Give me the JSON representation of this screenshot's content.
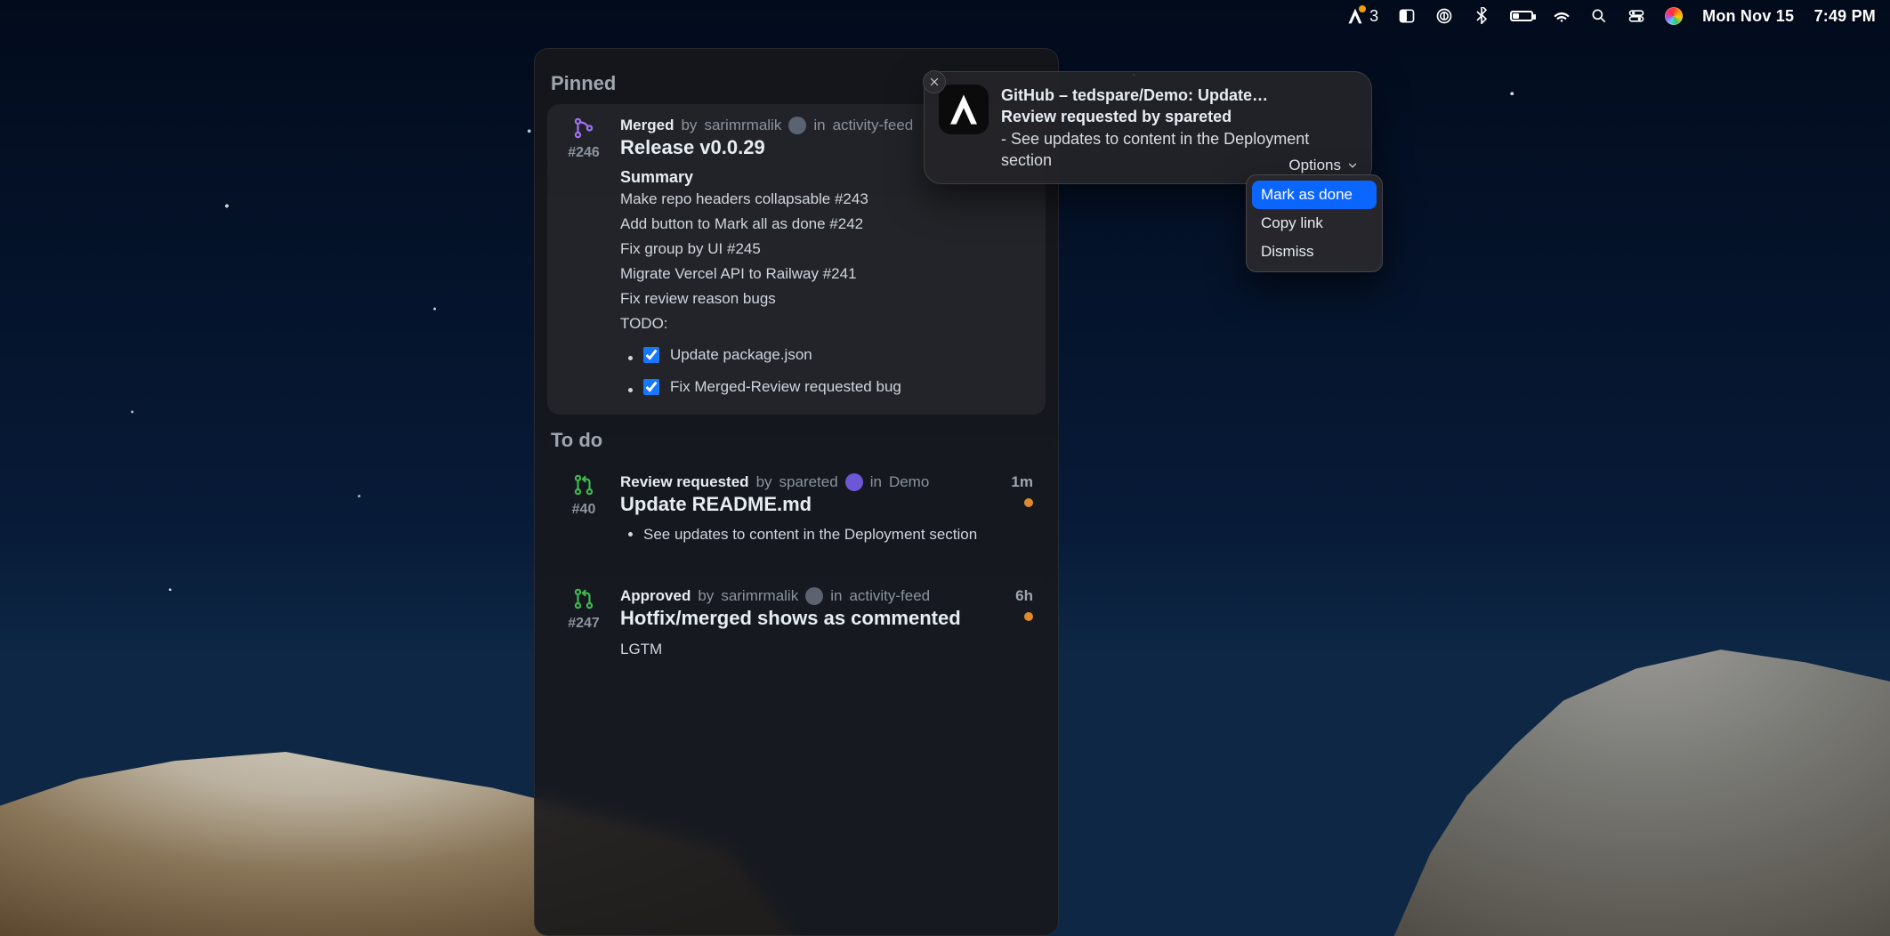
{
  "menubar": {
    "app_badge_count": "3",
    "date": "Mon Nov 15",
    "time": "7:49 PM"
  },
  "panel": {
    "sections": {
      "pinned_title": "Pinned",
      "todo_title": "To do"
    },
    "pinned": {
      "pr_id": "#246",
      "status": "Merged",
      "by_label": "by",
      "author": "sarimrmalik",
      "in_label": "in",
      "repo": "activity-feed",
      "title": "Release v0.0.29",
      "summary_label": "Summary",
      "lines": [
        "Make repo headers collapsable #243",
        "Add button to Mark all as done #242",
        "Fix group by UI #245",
        "Migrate Vercel API to Railway #241",
        "Fix review reason bugs",
        "TODO:"
      ],
      "todos": [
        {
          "checked": true,
          "text": "Update package.json"
        },
        {
          "checked": true,
          "text": "Fix Merged-Review requested bug"
        }
      ]
    },
    "todo": [
      {
        "pr_id": "#40",
        "status": "Review requested",
        "by_label": "by",
        "author": "spareted",
        "in_label": "in",
        "repo": "Demo",
        "title": "Update README.md",
        "time": "1m",
        "bullet": "See updates to content in the Deployment section"
      },
      {
        "pr_id": "#247",
        "status": "Approved",
        "by_label": "by",
        "author": "sarimrmalik",
        "in_label": "in",
        "repo": "activity-feed",
        "title": "Hotfix/merged shows as commented",
        "time": "6h",
        "body": "LGTM"
      }
    ]
  },
  "toast": {
    "line1": "GitHub – tedspare/Demo: Update…",
    "line2": "Review requested by spareted",
    "line3": "- See updates to content in the Deployment section",
    "options_label": "Options"
  },
  "options_menu": {
    "items": [
      "Mark as done",
      "Copy link",
      "Dismiss"
    ],
    "selected_index": 0
  }
}
